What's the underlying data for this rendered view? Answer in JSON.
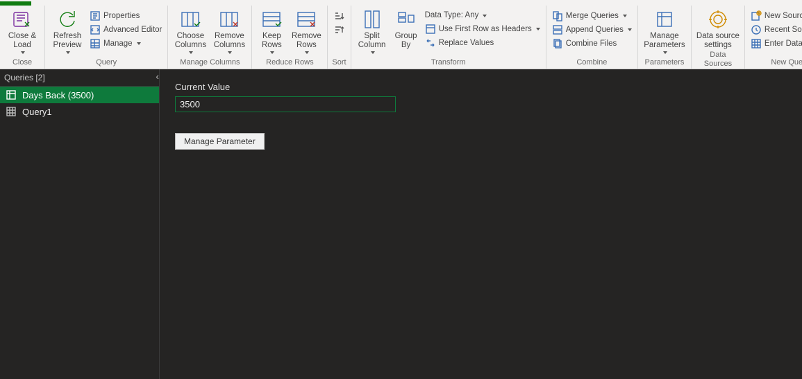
{
  "accent": "#107c10",
  "ribbon": {
    "close": {
      "close_load": "Close &\nLoad",
      "group_label": "Close"
    },
    "query": {
      "refresh": "Refresh\nPreview",
      "properties": "Properties",
      "advanced_editor": "Advanced Editor",
      "manage": "Manage",
      "group_label": "Query"
    },
    "manage_cols": {
      "choose": "Choose\nColumns",
      "remove": "Remove\nColumns",
      "group_label": "Manage Columns"
    },
    "reduce_rows": {
      "keep": "Keep\nRows",
      "remove": "Remove\nRows",
      "group_label": "Reduce Rows"
    },
    "sort": {
      "group_label": "Sort"
    },
    "transform": {
      "split": "Split\nColumn",
      "groupby": "Group\nBy",
      "data_type": "Data Type: Any",
      "first_row": "Use First Row as Headers",
      "replace": "Replace Values",
      "group_label": "Transform"
    },
    "combine": {
      "merge": "Merge Queries",
      "append": "Append Queries",
      "combine_files": "Combine Files",
      "group_label": "Combine"
    },
    "parameters": {
      "manage": "Manage\nParameters",
      "group_label": "Parameters"
    },
    "data_sources": {
      "settings": "Data source\nsettings",
      "group_label": "Data Sources"
    },
    "new_query": {
      "new_source": "New Source",
      "recent": "Recent Sources",
      "enter_data": "Enter Data",
      "group_label": "New Query"
    }
  },
  "queries": {
    "header": "Queries [2]",
    "items": [
      {
        "label": "Days Back (3500)",
        "kind": "parameter",
        "selected": true
      },
      {
        "label": "Query1",
        "kind": "table",
        "selected": false
      }
    ]
  },
  "detail": {
    "current_value_label": "Current Value",
    "current_value": "3500",
    "manage_parameter": "Manage Parameter"
  }
}
